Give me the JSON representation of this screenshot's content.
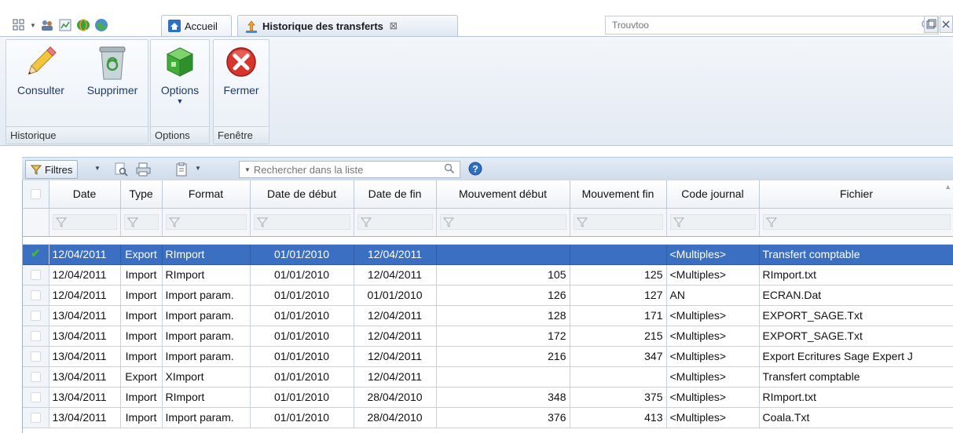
{
  "tabs": {
    "home_label": "Accueil",
    "active_label": "Historique des transferts"
  },
  "global_search": {
    "placeholder": "Trouvtoo"
  },
  "ribbon": {
    "groups": [
      {
        "title": "Historique",
        "buttons": [
          "Consulter",
          "Supprimer"
        ]
      },
      {
        "title": "Options",
        "buttons": [
          "Options"
        ]
      },
      {
        "title": "Fenêtre",
        "buttons": [
          "Fermer"
        ]
      }
    ]
  },
  "grid_toolbar": {
    "filters_label": "Filtres",
    "search_placeholder": "Rechercher dans la liste"
  },
  "table": {
    "columns": [
      "Date",
      "Type",
      "Format",
      "Date de début",
      "Date de fin",
      "Mouvement début",
      "Mouvement fin",
      "Code journal",
      "Fichier"
    ],
    "rows": [
      {
        "checked": true,
        "selected": true,
        "cells": [
          "12/04/2011",
          "Export",
          "RImport",
          "01/01/2010",
          "12/04/2011",
          "",
          "",
          "<Multiples>",
          "Transfert comptable"
        ]
      },
      {
        "checked": false,
        "selected": false,
        "cells": [
          "12/04/2011",
          "Import",
          "RImport",
          "01/01/2010",
          "12/04/2011",
          "105",
          "125",
          "<Multiples>",
          "RImport.txt"
        ]
      },
      {
        "checked": false,
        "selected": false,
        "cells": [
          "12/04/2011",
          "Import",
          "Import param.",
          "01/01/2010",
          "01/01/2010",
          "126",
          "127",
          "AN",
          "ECRAN.Dat"
        ]
      },
      {
        "checked": false,
        "selected": false,
        "cells": [
          "13/04/2011",
          "Import",
          "Import param.",
          "01/01/2010",
          "12/04/2011",
          "128",
          "171",
          "<Multiples>",
          "EXPORT_SAGE.Txt"
        ]
      },
      {
        "checked": false,
        "selected": false,
        "cells": [
          "13/04/2011",
          "Import",
          "Import param.",
          "01/01/2010",
          "12/04/2011",
          "172",
          "215",
          "<Multiples>",
          "EXPORT_SAGE.Txt"
        ]
      },
      {
        "checked": false,
        "selected": false,
        "cells": [
          "13/04/2011",
          "Import",
          "Import param.",
          "01/01/2010",
          "12/04/2011",
          "216",
          "347",
          "<Multiples>",
          "Export Ecritures Sage Expert J"
        ]
      },
      {
        "checked": false,
        "selected": false,
        "cells": [
          "13/04/2011",
          "Export",
          "XImport",
          "01/01/2010",
          "12/04/2011",
          "",
          "",
          "<Multiples>",
          "Transfert comptable"
        ]
      },
      {
        "checked": false,
        "selected": false,
        "cells": [
          "13/04/2011",
          "Import",
          "RImport",
          "01/01/2010",
          "28/04/2010",
          "348",
          "375",
          "<Multiples>",
          "RImport.txt"
        ]
      },
      {
        "checked": false,
        "selected": false,
        "cells": [
          "13/04/2011",
          "Import",
          "Import param.",
          "01/01/2010",
          "28/04/2010",
          "376",
          "413",
          "<Multiples>",
          "Coala.Txt"
        ]
      }
    ]
  },
  "colors": {
    "selection": "#3b6fc1",
    "accent": "#1b3a6b",
    "close_red": "#d9342b",
    "options_green": "#3fae3a"
  }
}
